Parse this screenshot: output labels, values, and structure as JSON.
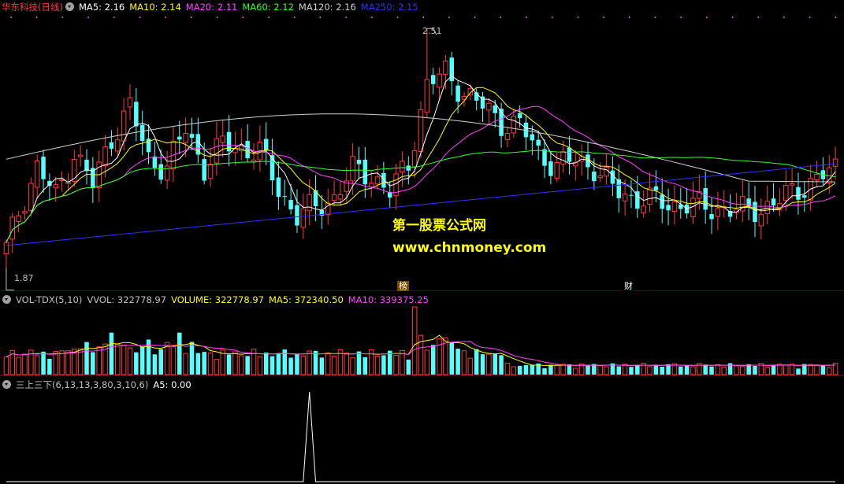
{
  "main_header": {
    "stock": "华东科技(日线)",
    "ma5": "MA5: 2.16",
    "ma10": "MA10: 2.14",
    "ma20": "MA20: 2.11",
    "ma60": "MA60: 2.12",
    "ma120": "MA120: 2.16",
    "ma250": "MA250: 2.15"
  },
  "main_labels": {
    "high": "2.51",
    "low": "1.87"
  },
  "markers": {
    "bang": "榜",
    "cai": "财"
  },
  "vol_header": {
    "name": "VOL-TDX(5,10)",
    "vvol": "VVOL: 322778.97",
    "volume": "VOLUME: 322778.97",
    "ma5": "MA5: 372340.50",
    "ma10": "MA10: 339375.25"
  },
  "ind_header": {
    "name": "三上三下(6,13,13,3,80,3,10,6)",
    "a5": "A5: 0.00"
  },
  "watermark": {
    "line1": "第一股票公式网",
    "line2": "www.chnmoney.com"
  },
  "colors": {
    "up": "#ff3c3c",
    "down": "#54ffff",
    "ma5": "#ffffff",
    "ma10": "#ffff00",
    "ma20": "#ff44ff",
    "ma60": "#33ff33",
    "ma120": "#d0d0d0",
    "ma250": "#3030ff",
    "grid": "#8b1a1a"
  },
  "chart_data": {
    "type": "candlestick",
    "price_range": [
      1.87,
      2.51
    ],
    "a5_peak": 1,
    "a5_peak_bar": 49
  }
}
